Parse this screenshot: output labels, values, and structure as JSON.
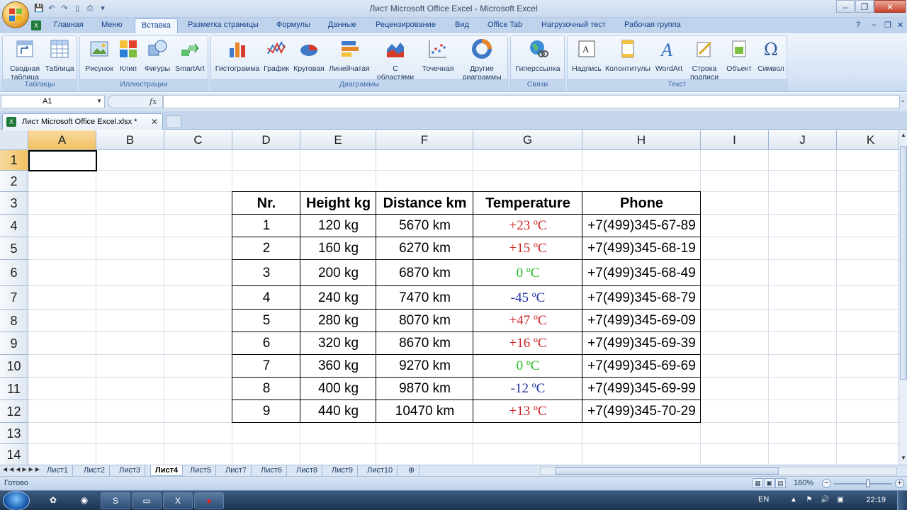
{
  "window": {
    "title": "Лист Microsoft Office Excel - Microsoft Excel",
    "minimize": "–",
    "restore": "❐",
    "close": "✕"
  },
  "ribbon_tabs": [
    "Главная",
    "Меню",
    "Вставка",
    "Разметка страницы",
    "Формулы",
    "Данные",
    "Рецензирование",
    "Вид",
    "Office Tab",
    "Нагрузочный тест",
    "Рабочая группа"
  ],
  "active_tab": "Вставка",
  "ribbon": {
    "groups": {
      "tables": "Таблицы",
      "illustrations": "Иллюстрации",
      "charts": "Диаграммы",
      "links": "Связи",
      "text": "Текст"
    },
    "buttons": {
      "pivot_1": "Сводная",
      "pivot_2": "таблица",
      "table": "Таблица",
      "picture": "Рисунок",
      "clip": "Клип",
      "shapes": "Фигуры",
      "smartart": "SmartArt",
      "column": "Гистограмма",
      "line": "График",
      "pie": "Круговая",
      "bar": "Линейчатая",
      "area_1": "С",
      "area_2": "областями",
      "scatter": "Точечная",
      "other_1": "Другие",
      "other_2": "диаграммы",
      "hyperlink": "Гиперссылка",
      "textbox": "Надпись",
      "header_footer": "Колонтитулы",
      "wordart": "WordArt",
      "signature_1": "Строка",
      "signature_2": "подписи",
      "object": "Объект",
      "symbol": "Символ"
    }
  },
  "formula_bar": {
    "name_box": "A1",
    "fx": "fx",
    "value": ""
  },
  "document_tab": {
    "name": "Лист Microsoft Office Excel.xlsx *",
    "close": "✕"
  },
  "columns": [
    "A",
    "B",
    "C",
    "D",
    "E",
    "F",
    "G",
    "H",
    "I",
    "J",
    "K"
  ],
  "rows": [
    "1",
    "2",
    "3",
    "4",
    "5",
    "6",
    "7",
    "8",
    "9",
    "10",
    "11",
    "12",
    "13",
    "14"
  ],
  "selected_cell": "A1",
  "table": {
    "headers": [
      "Nr.",
      "Height kg",
      "Distance km",
      "Temperature",
      "Phone"
    ],
    "rows": [
      [
        "1",
        "120 kg",
        "5670 km",
        "+23 ºC",
        "+7(499)345-67-89"
      ],
      [
        "2",
        "160 kg",
        "6270 km",
        "+15 ºC",
        "+7(499)345-68-19"
      ],
      [
        "3",
        "200 kg",
        "6870 km",
        "0 ºC",
        "+7(499)345-68-49"
      ],
      [
        "4",
        "240 kg",
        "7470 km",
        "-45 ºC",
        "+7(499)345-68-79"
      ],
      [
        "5",
        "280 kg",
        "8070 km",
        "+47 ºC",
        "+7(499)345-69-09"
      ],
      [
        "6",
        "320 kg",
        "8670 km",
        "+16 ºC",
        "+7(499)345-69-39"
      ],
      [
        "7",
        "360 kg",
        "9270 km",
        "0 ºC",
        "+7(499)345-69-69"
      ],
      [
        "8",
        "400 kg",
        "9870 km",
        "-12 ºC",
        "+7(499)345-69-99"
      ],
      [
        "9",
        "440 kg",
        "10470 km",
        "+13 ºC",
        "+7(499)345-70-29"
      ]
    ],
    "temp_colors": [
      "#cc2222",
      "#cc2222",
      "#22bb22",
      "#1f2fa0",
      "#cc2222",
      "#cc2222",
      "#22bb22",
      "#1f2fa0",
      "#cc2222"
    ]
  },
  "sheets": [
    "Лист1",
    "Лист2",
    "Лист3",
    "Лист4",
    "Лист5",
    "Лист7",
    "Лист6",
    "Лист8",
    "Лист9",
    "Лист10"
  ],
  "active_sheet": "Лист4",
  "status": {
    "ready": "Готово",
    "zoom": "160%"
  },
  "taskbar": {
    "lang": "EN",
    "time": "22:19"
  }
}
